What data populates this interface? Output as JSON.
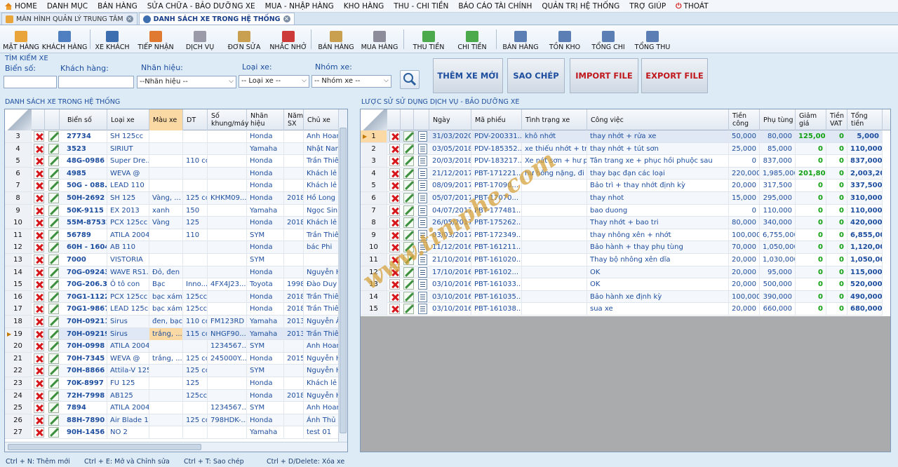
{
  "menu": {
    "home": "HOME",
    "items": [
      "DANH MỤC",
      "BÁN HÀNG",
      "SỬA CHỮA - BẢO DƯỠNG XE",
      "MUA - NHẬP HÀNG",
      "KHO HÀNG",
      "THU - CHI TIỀN",
      "BÁO CÁO TÀI CHÍNH",
      "QUẢN TRỊ HỆ THỐNG",
      "TRỢ GIÚP"
    ],
    "exit": "THOÁT"
  },
  "tabs": [
    {
      "label": "MÀN HÌNH QUẢN LÝ TRUNG TÂM",
      "active": false
    },
    {
      "label": "DANH SÁCH XE TRONG HỆ THỐNG",
      "active": true
    }
  ],
  "toolbar": [
    {
      "label": "MẶT HÀNG",
      "icon": "box-icon",
      "color": "#e9a43a"
    },
    {
      "label": "KHÁCH HÀNG",
      "icon": "customer-icon",
      "color": "#4f7fc0"
    },
    {
      "label": "XE KHÁCH",
      "icon": "car-icon",
      "color": "#3d6fb0"
    },
    {
      "label": "TIẾP NHẬN",
      "icon": "reception-icon",
      "color": "#e07a30"
    },
    {
      "label": "DỊCH VỤ",
      "icon": "tools-icon",
      "color": "#9a9aa8"
    },
    {
      "label": "ĐƠN SỬA",
      "icon": "repair-order-icon",
      "color": "#c9a050"
    },
    {
      "label": "NHẮC NHỞ",
      "icon": "calendar-icon",
      "color": "#cc3a3a"
    },
    {
      "label": "BÁN HÀNG",
      "icon": "sales-icon",
      "color": "#c9a050"
    },
    {
      "label": "MUA HÀNG",
      "icon": "cart-icon",
      "color": "#8c8c9a"
    },
    {
      "label": "THU TIỀN",
      "icon": "money-in-icon",
      "color": "#4caa4c"
    },
    {
      "label": "CHI TIỀN",
      "icon": "money-out-icon",
      "color": "#4caa4c"
    },
    {
      "label": "BÁN HÀNG",
      "icon": "sales-report-icon",
      "color": "#5b7fb5"
    },
    {
      "label": "TỒN KHO",
      "icon": "stock-report-icon",
      "color": "#5b7fb5"
    },
    {
      "label": "TỔNG CHI",
      "icon": "expense-report-icon",
      "color": "#5b7fb5"
    },
    {
      "label": "TỔNG THU",
      "icon": "income-report-icon",
      "color": "#5b7fb5"
    }
  ],
  "search": {
    "title": "TÌM KIẾM XE",
    "plate_label": "Biển số:",
    "plate_value": "",
    "customer_label": "Khách hàng:",
    "customer_value": "",
    "brand_label": "Nhãn hiệu:",
    "brand_value": "--Nhãn hiệu --",
    "type_label": "Loại xe:",
    "type_value": "-- Loại xe --",
    "group_label": "Nhóm xe:",
    "group_value": "-- Nhóm xe --"
  },
  "actions": {
    "add": "THÊM XE MỚI",
    "copy": "SAO CHÉP",
    "import": "IMPORT FILE",
    "export": "EXPORT FILE"
  },
  "vehicles": {
    "title": "DANH SÁCH XE TRONG HỆ THỐNG",
    "columns": [
      "Biển số",
      "Loại xe",
      "Màu xe",
      "DT",
      "Số khung/máy",
      "Nhãn hiệu",
      "Năm SX",
      "Chủ xe"
    ],
    "selected_row": "19",
    "rows": [
      [
        "3",
        "27734",
        "SH 125cc",
        "",
        "",
        "",
        "Honda",
        "",
        "Anh Hoan"
      ],
      [
        "4",
        "3523",
        "SIRIUT",
        "",
        "",
        "",
        "Yamaha",
        "",
        "Nhật Nam"
      ],
      [
        "5",
        "48G-0986",
        "Super Dre...",
        "",
        "110 cc",
        "",
        "Honda",
        "",
        "Trần Thiên"
      ],
      [
        "6",
        "4985",
        "WEVA @",
        "",
        "",
        "",
        "Honda",
        "",
        "Khách lẻ"
      ],
      [
        "7",
        "50G - 088...",
        "LEAD 110",
        "",
        "",
        "",
        "Honda",
        "",
        "Khách lẻ"
      ],
      [
        "8",
        "50H-2692",
        "SH 125",
        "Vàng, ...",
        "125 cc",
        "KHKM09...",
        "Honda",
        "2018",
        "Hồ Long"
      ],
      [
        "9",
        "50K-9115",
        "EX 2013",
        "xanh",
        "150",
        "",
        "Yamaha",
        "",
        "Ngọc Sinh"
      ],
      [
        "10",
        "55M-87532",
        "PCX 125cc",
        "Vàng",
        "125",
        "",
        "Honda",
        "2018",
        "Khách lẻ"
      ],
      [
        "11",
        "56789",
        "ATILA 2004",
        "",
        "110",
        "",
        "SYM",
        "",
        "Trần Thiên"
      ],
      [
        "12",
        "60H - 1604",
        "AB 110",
        "",
        "",
        "",
        "Honda",
        "",
        "bác Phi"
      ],
      [
        "13",
        "7000",
        "VISTORIA",
        "",
        "",
        "",
        "SYM",
        "",
        ""
      ],
      [
        "14",
        "70G-092433",
        "WAVE RS1...",
        "Đỏ, đen",
        "",
        "",
        "Honda",
        "",
        "Nguyễn Hồ"
      ],
      [
        "15",
        "70G-206.35",
        "Ô tô con",
        "Bạc",
        "Inno...",
        "4FX4J23...",
        "Toyota",
        "1998",
        "Đào Duy K"
      ],
      [
        "16",
        "70G1-11221",
        "PCX 125cc",
        "bạc xám",
        "125cc",
        "",
        "Honda",
        "2018",
        "Trần Thiên"
      ],
      [
        "17",
        "70G1-9867",
        "LEAD 125cc",
        "bạc xám",
        "125cc",
        "",
        "Honda",
        "2018",
        "Trần Thiên"
      ],
      [
        "18",
        "70H-09211",
        "Sirus",
        "đen, bạc",
        "110 cc",
        "FM123RD",
        "Yamaha",
        "2013",
        "Nguyễn Ân"
      ],
      [
        "19",
        "70H-09219",
        "Sirus",
        "trắng, ...",
        "115 cc",
        "NHGF90...",
        "Yamaha",
        "2013",
        "Trần Thiên"
      ],
      [
        "20",
        "70H-0998",
        "ATILA 2004",
        "",
        "",
        "1234567...",
        "SYM",
        "",
        "Anh Hoan"
      ],
      [
        "21",
        "70H-7345",
        "WEVA @",
        "trắng, ...",
        "125 cc",
        "245000Y...",
        "Honda",
        "2015",
        "Nguyễn Hồ"
      ],
      [
        "22",
        "70H-8866",
        "Attila-V 125...",
        "",
        "125 cc",
        "",
        "SYM",
        "",
        "Nguyễn Hồ"
      ],
      [
        "23",
        "70K-8997",
        "FU 125",
        "",
        "125",
        "",
        "Honda",
        "",
        "Khách lẻ"
      ],
      [
        "24",
        "72H-7998",
        "AB125",
        "",
        "125cc",
        "",
        "Honda",
        "2018",
        "Nguyễn Hồ"
      ],
      [
        "25",
        "7894",
        "ATILA 2004",
        "",
        "",
        "1234567...",
        "SYM",
        "",
        "Anh Hoan"
      ],
      [
        "26",
        "88H-7890",
        "Air Blade 1...",
        "",
        "125 cc",
        "798HDK-...",
        "Honda",
        "",
        "Ánh Thủ"
      ],
      [
        "27",
        "90H-1456",
        "NO 2",
        "",
        "",
        "",
        "Yamaha",
        "",
        "test 01"
      ]
    ]
  },
  "history": {
    "title": "LƯỢC SỬ SỬ DỤNG DỊCH VỤ - BẢO DƯỠNG XE",
    "columns": [
      "Ngày",
      "Mã phiếu",
      "Tình trạng xe",
      "Công việc",
      "Tiền công",
      "Phụ tùng",
      "Giảm giá",
      "Tiền VAT",
      "Tổng tiền"
    ],
    "rows": [
      [
        "1",
        "31/03/2020",
        "PDV-200331...",
        "khô nhớt",
        "thay nhớt + rửa xe",
        "50,000",
        "80,000",
        "125,000",
        "0",
        "5,000"
      ],
      [
        "2",
        "03/05/2018",
        "PDV-185352...",
        "xe thiếu nhớt + trớ...",
        "thay nhớt + tút sơn",
        "25,000",
        "85,000",
        "0",
        "0",
        "110,000"
      ],
      [
        "3",
        "20/03/2018",
        "PDV-183217...",
        "Xe nát sơn + hư p...",
        "Tân trang xe + phục hồi phuộc sau",
        "0",
        "837,000",
        "0",
        "0",
        "837,000"
      ],
      [
        "4",
        "21/12/2017",
        "PBT-171221...",
        "hư hỏng nặng, đi ...",
        "thay bạc đạn các loại",
        "220,000",
        "1,985,000",
        "201,800",
        "0",
        "2,003,200"
      ],
      [
        "5",
        "08/09/2017",
        "PBT-17090...",
        "",
        "Bảo trì + thay nhớt định kỳ",
        "20,000",
        "317,500",
        "0",
        "0",
        "337,500"
      ],
      [
        "6",
        "05/07/2017",
        "PBT-17070...",
        "",
        "thay nhot",
        "15,000",
        "295,000",
        "0",
        "0",
        "310,000"
      ],
      [
        "7",
        "04/07/2017",
        "PBT-177481...",
        "",
        "bao duong",
        "0",
        "110,000",
        "0",
        "0",
        "110,000"
      ],
      [
        "8",
        "26/05/2017",
        "PBT-175262...",
        "",
        "Thay nhớt + bao tri",
        "80,000",
        "340,000",
        "0",
        "0",
        "420,000"
      ],
      [
        "9",
        "03/03/2017",
        "PBT-172349...",
        "",
        "thay nhông xên + nhớt",
        "100,000",
        "6,755,000",
        "0",
        "0",
        "6,855,000"
      ],
      [
        "10",
        "11/12/2016",
        "PBT-161211...",
        "",
        "Bảo hành + thay phụ tùng",
        "70,000",
        "1,050,000",
        "0",
        "0",
        "1,120,000"
      ],
      [
        "11",
        "21/10/2016",
        "PBT-161020...",
        "",
        "Thay bộ nhông xên dĩa",
        "20,000",
        "1,030,000",
        "0",
        "0",
        "1,050,000"
      ],
      [
        "12",
        "17/10/2016",
        "PBT-16102...",
        "",
        "OK",
        "20,000",
        "95,000",
        "0",
        "0",
        "115,000"
      ],
      [
        "13",
        "03/10/2016",
        "PBT-161033...",
        "",
        "OK",
        "20,000",
        "500,000",
        "0",
        "0",
        "520,000"
      ],
      [
        "14",
        "03/10/2016",
        "PBT-161035...",
        "",
        "Bảo hành xe định kỳ",
        "100,000",
        "390,000",
        "0",
        "0",
        "490,000"
      ],
      [
        "15",
        "03/10/2016",
        "PBT-161038...",
        "",
        "sua xe",
        "20,000",
        "660,000",
        "0",
        "0",
        "680,000"
      ]
    ]
  },
  "status": {
    "add": "Ctrl + N: Thêm mới",
    "edit": "Ctrl + E:  Mở và Chỉnh sửa",
    "copy": "Ctrl + T:  Sao chép",
    "delete": "Ctrl + D/Delete:  Xóa xe"
  },
  "watermark": "www.timphe.com"
}
